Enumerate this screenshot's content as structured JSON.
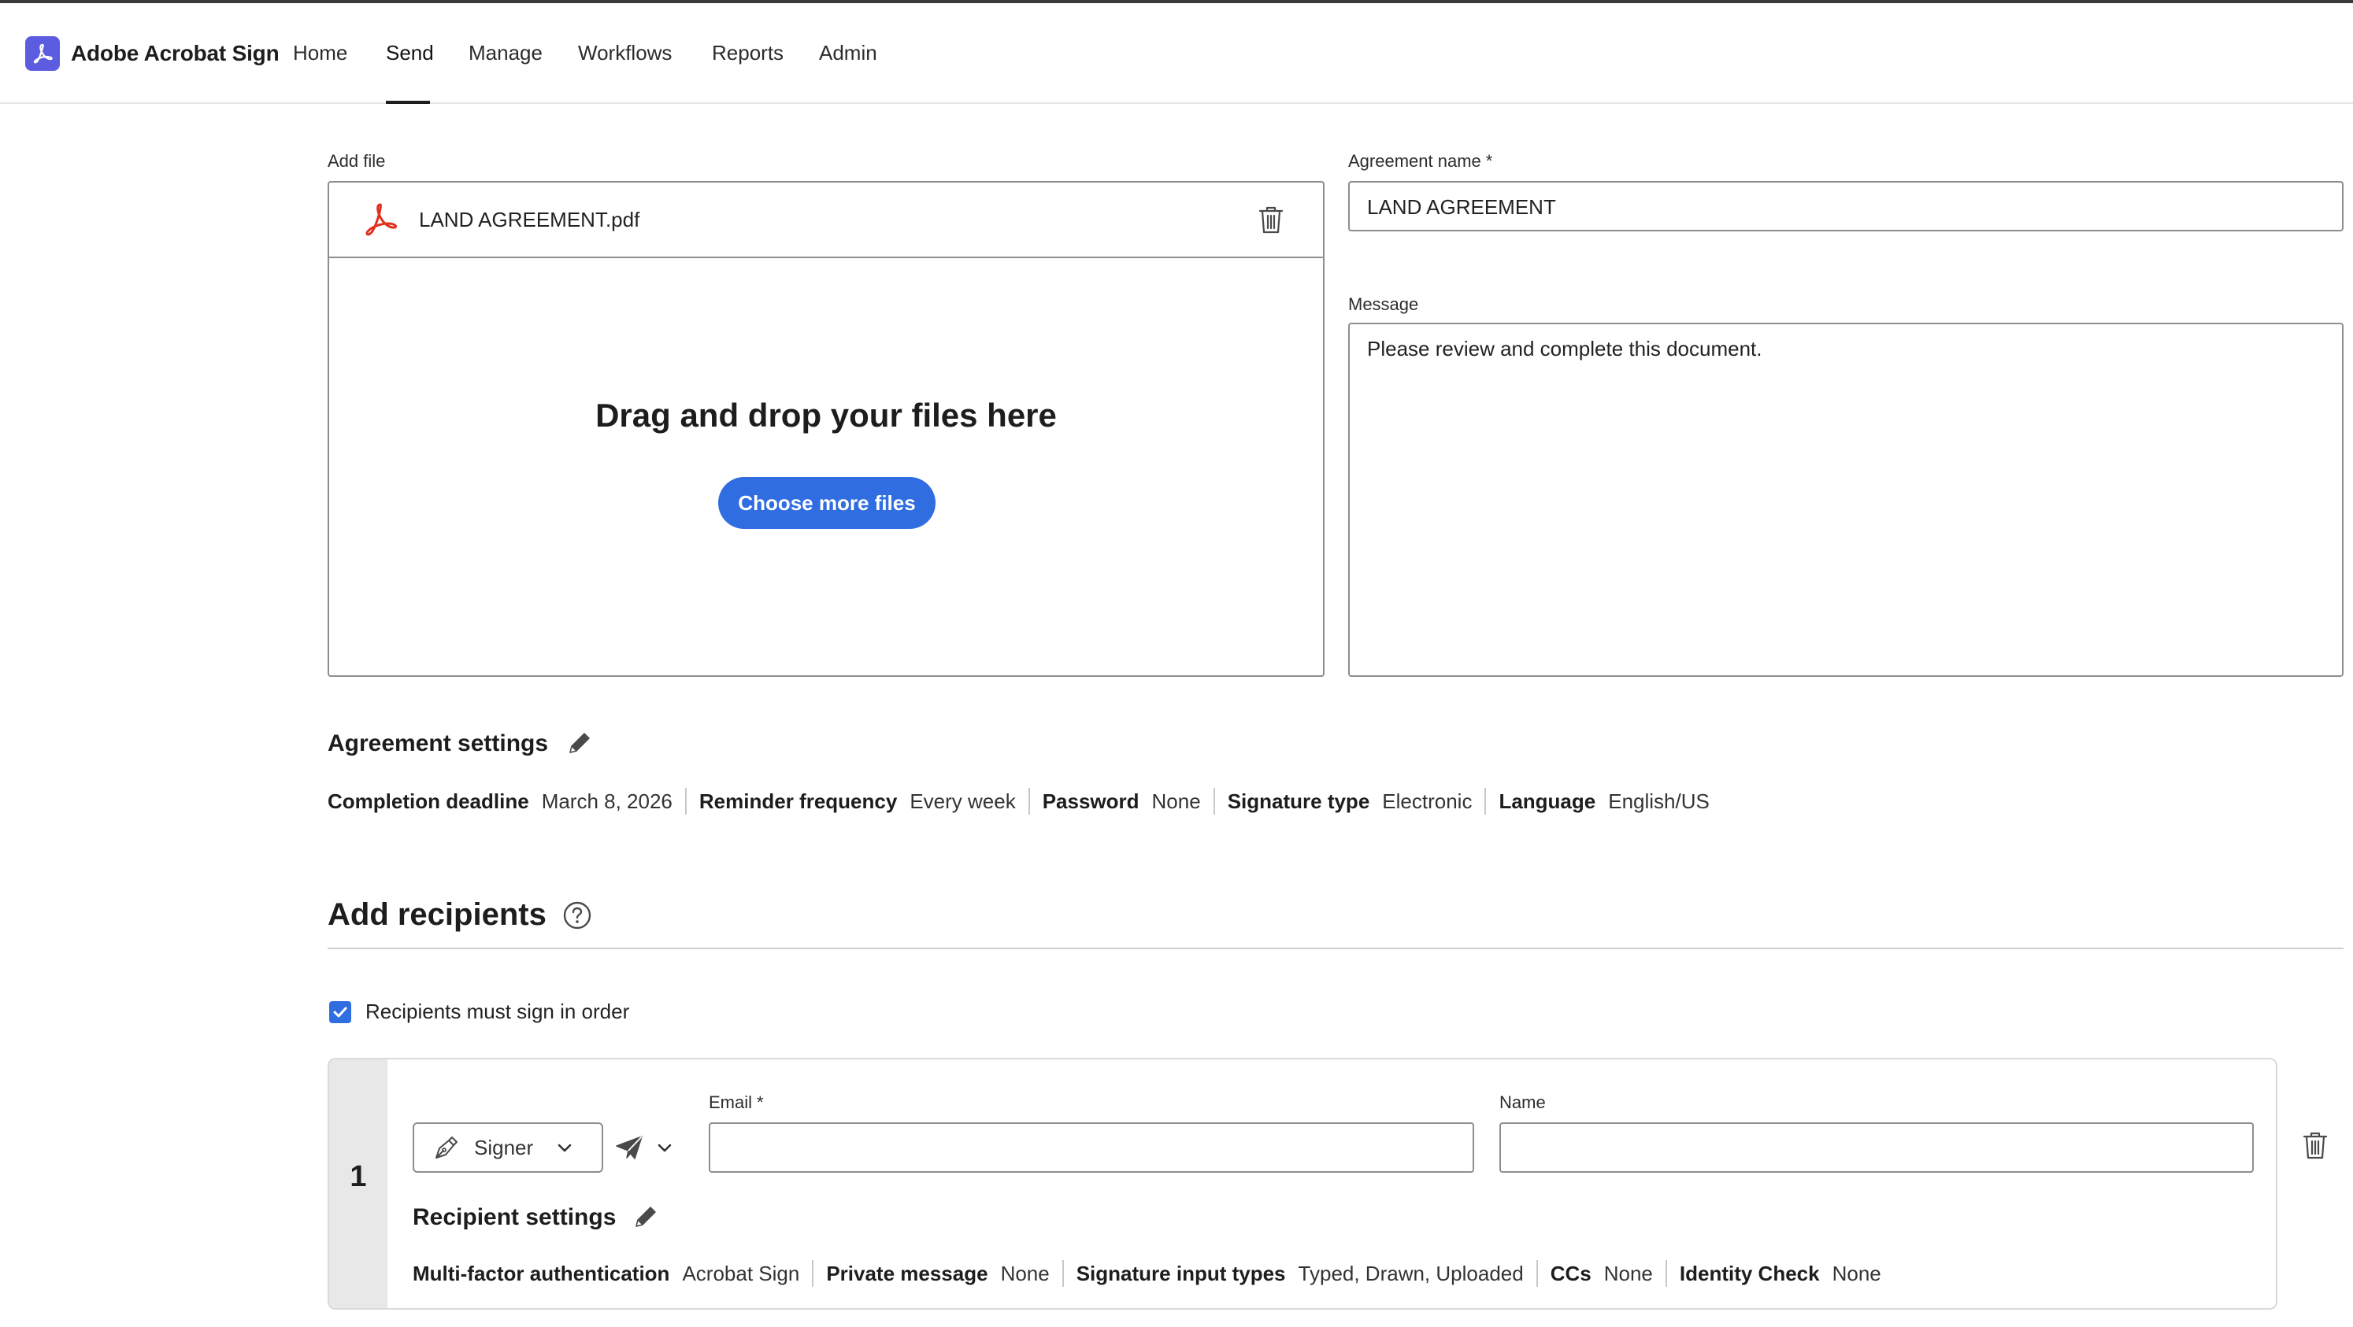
{
  "app": {
    "name": "Adobe Acrobat Sign",
    "nav": [
      {
        "label": "Home"
      },
      {
        "label": "Send",
        "active": true
      },
      {
        "label": "Manage"
      },
      {
        "label": "Workflows"
      },
      {
        "label": "Reports"
      },
      {
        "label": "Admin"
      }
    ]
  },
  "file": {
    "section_label": "Add file",
    "file_name": "LAND AGREEMENT.pdf",
    "drop_text": "Drag and drop your files here",
    "choose_button": "Choose more files"
  },
  "agreement": {
    "name_label": "Agreement name",
    "required_mark": "*",
    "name_value": "LAND AGREEMENT",
    "message_label": "Message",
    "message_value": "Please review and complete this document."
  },
  "settings": {
    "title": "Agreement settings",
    "items": [
      {
        "key": "Completion deadline",
        "value": "March 8, 2026"
      },
      {
        "key": "Reminder frequency",
        "value": "Every week"
      },
      {
        "key": "Password",
        "value": "None"
      },
      {
        "key": "Signature type",
        "value": "Electronic"
      },
      {
        "key": "Language",
        "value": "English/US"
      }
    ]
  },
  "recipients": {
    "title": "Add recipients",
    "sign_in_order_label": "Recipients must sign in order",
    "sign_in_order_checked": true,
    "list": [
      {
        "number": "1",
        "role": "Signer",
        "email_label": "Email",
        "email_required_mark": "*",
        "email_value": "",
        "name_label": "Name",
        "name_value": "",
        "settings_title": "Recipient settings",
        "settings": [
          {
            "key": "Multi-factor authentication",
            "value": "Acrobat Sign"
          },
          {
            "key": "Private message",
            "value": "None"
          },
          {
            "key": "Signature input types",
            "value": "Typed, Drawn, Uploaded"
          },
          {
            "key": "CCs",
            "value": "None"
          },
          {
            "key": "Identity Check",
            "value": "None"
          }
        ]
      }
    ]
  },
  "icons": {
    "brand": "acrobat-logo-icon",
    "file": "pdf-icon",
    "delete": "trash-icon",
    "edit": "pencil-icon",
    "help": "help-circle-icon",
    "role": "pen-nib-icon",
    "delivery": "paper-plane-icon",
    "dropdown": "chevron-down-icon"
  },
  "colors": {
    "accent": "#2f6de1",
    "brand": "#5c5ce0",
    "pdf": "#e0301e"
  }
}
